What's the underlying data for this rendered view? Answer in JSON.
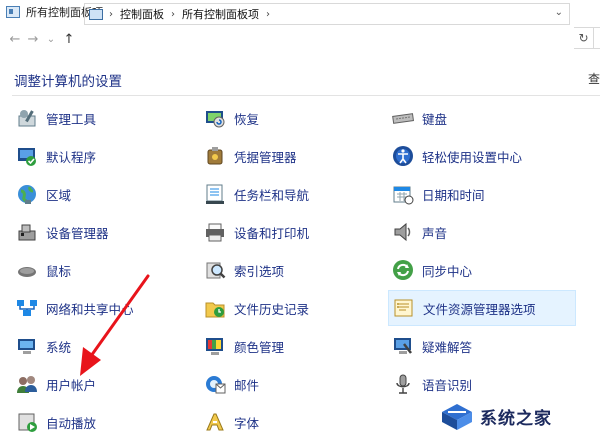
{
  "window": {
    "title": "所有控制面板项"
  },
  "nav": {
    "back": "←",
    "forward": "→",
    "recent": "⌄",
    "up": "↑",
    "refresh": "↻",
    "breadcrumb": [
      "控制面板",
      "所有控制面板项"
    ],
    "separator": "›",
    "dropdown": "⌄"
  },
  "heading": "调整计算机的设置",
  "view_by": "查",
  "items": [
    {
      "label": "管理工具",
      "icon": "admin-tools-icon"
    },
    {
      "label": "默认程序",
      "icon": "default-programs-icon"
    },
    {
      "label": "区域",
      "icon": "region-globe-icon"
    },
    {
      "label": "设备管理器",
      "icon": "device-manager-icon"
    },
    {
      "label": "鼠标",
      "icon": "mouse-icon"
    },
    {
      "label": "网络和共享中心",
      "icon": "network-icon"
    },
    {
      "label": "系统",
      "icon": "system-icon"
    },
    {
      "label": "用户帐户",
      "icon": "user-accounts-icon"
    },
    {
      "label": "自动播放",
      "icon": "autoplay-icon"
    },
    {
      "label": "恢复",
      "icon": "recovery-icon"
    },
    {
      "label": "凭据管理器",
      "icon": "credential-manager-icon"
    },
    {
      "label": "任务栏和导航",
      "icon": "taskbar-icon"
    },
    {
      "label": "设备和打印机",
      "icon": "printer-icon"
    },
    {
      "label": "索引选项",
      "icon": "indexing-icon"
    },
    {
      "label": "文件历史记录",
      "icon": "file-history-icon"
    },
    {
      "label": "颜色管理",
      "icon": "color-management-icon"
    },
    {
      "label": "邮件",
      "icon": "mail-icon"
    },
    {
      "label": "字体",
      "icon": "fonts-icon"
    },
    {
      "label": "键盘",
      "icon": "keyboard-icon"
    },
    {
      "label": "轻松使用设置中心",
      "icon": "ease-of-access-icon"
    },
    {
      "label": "日期和时间",
      "icon": "date-time-icon"
    },
    {
      "label": "声音",
      "icon": "speaker-icon"
    },
    {
      "label": "同步中心",
      "icon": "sync-center-icon"
    },
    {
      "label": "文件资源管理器选项",
      "icon": "folder-options-icon",
      "selected": true
    },
    {
      "label": "疑难解答",
      "icon": "troubleshooting-icon"
    },
    {
      "label": "语音识别",
      "icon": "microphone-icon"
    }
  ],
  "watermark": {
    "text": "系统之家"
  },
  "colors": {
    "link": "#1e3287",
    "selection": "#e5f3ff",
    "arrow": "#e8141b"
  }
}
